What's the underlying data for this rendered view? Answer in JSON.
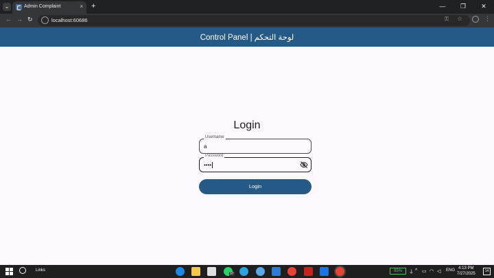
{
  "browser": {
    "tab_title": "Admin Complaint",
    "tab_close": "×",
    "new_tab": "+",
    "url": "localhost:60686",
    "window_controls": [
      "—",
      "❐",
      "✕"
    ]
  },
  "app": {
    "title": "Control Panel | لوحة التحكم",
    "login_title": "Login",
    "username": {
      "label": "Username",
      "value": "a"
    },
    "password": {
      "label": "Password",
      "value": "••••"
    },
    "login_button": "Login"
  },
  "taskbar": {
    "links_label": "Links",
    "whatsapp_badge": "97",
    "battery": "95%",
    "language": "ENG",
    "time": "4:13 PM",
    "date": "7/27/2025",
    "notification_count": "14"
  },
  "colors": {
    "appbar": "#265a86",
    "page_bg": "#fdf7fe",
    "battery": "#4cc35a"
  }
}
